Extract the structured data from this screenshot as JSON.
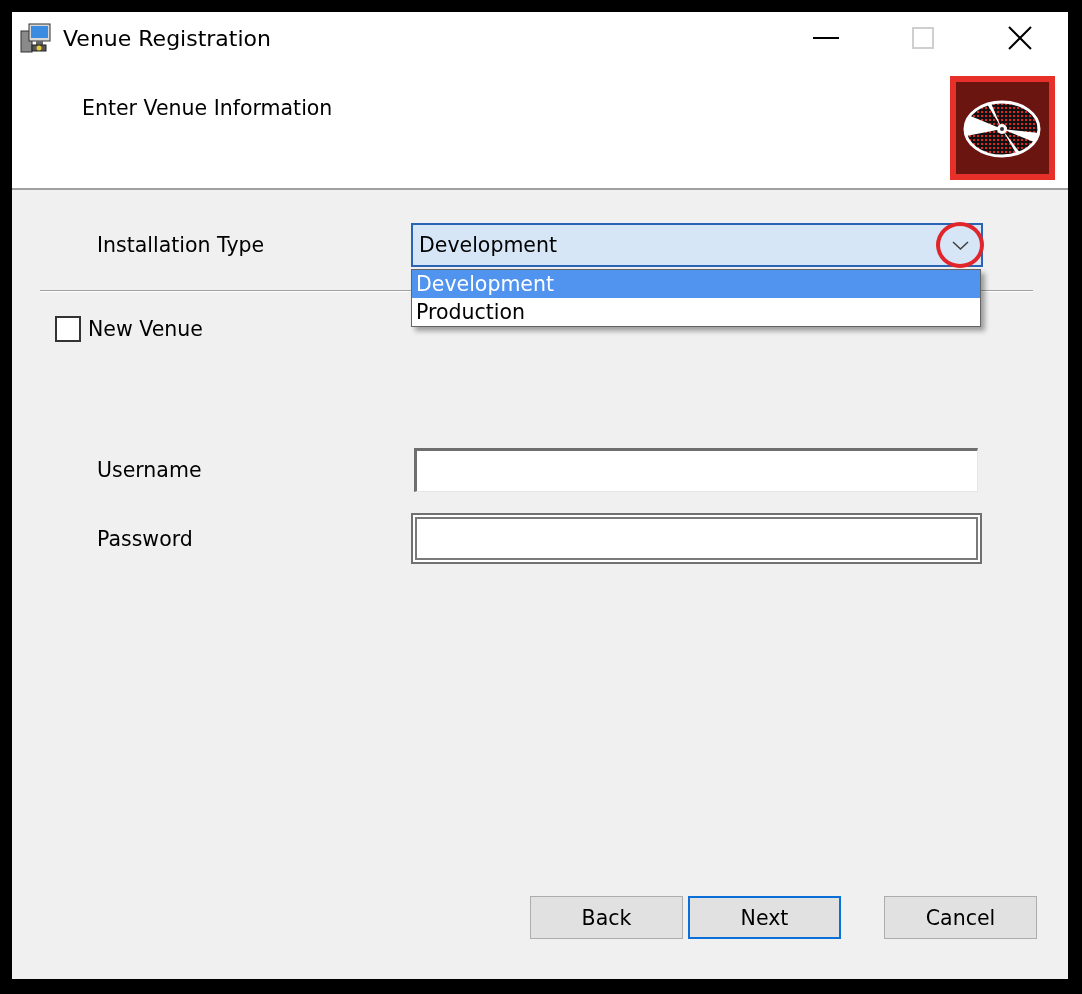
{
  "window": {
    "title": "Venue Registration",
    "controls": [
      {
        "kind": "minimize",
        "disabled": false
      },
      {
        "kind": "maximize",
        "disabled": true
      },
      {
        "kind": "close",
        "disabled": false
      }
    ]
  },
  "header": {
    "title": "Enter Venue Information"
  },
  "logo": {
    "highlighted": true
  },
  "installation_type": {
    "label": "Installation Type",
    "value": "Development",
    "expanded": true,
    "arrow_highlighted": true,
    "options": [
      {
        "label": "Development",
        "selected": true
      },
      {
        "label": "Production",
        "selected": false
      }
    ]
  },
  "new_venue": {
    "label": "New Venue",
    "checked": false
  },
  "fields": [
    {
      "label": "Username",
      "kind": "text"
    },
    {
      "label": "Password",
      "kind": "password"
    }
  ],
  "buttons": [
    {
      "label": "Back",
      "focused": false
    },
    {
      "label": "Next",
      "focused": true
    },
    {
      "label": "Cancel",
      "focused": false
    }
  ]
}
